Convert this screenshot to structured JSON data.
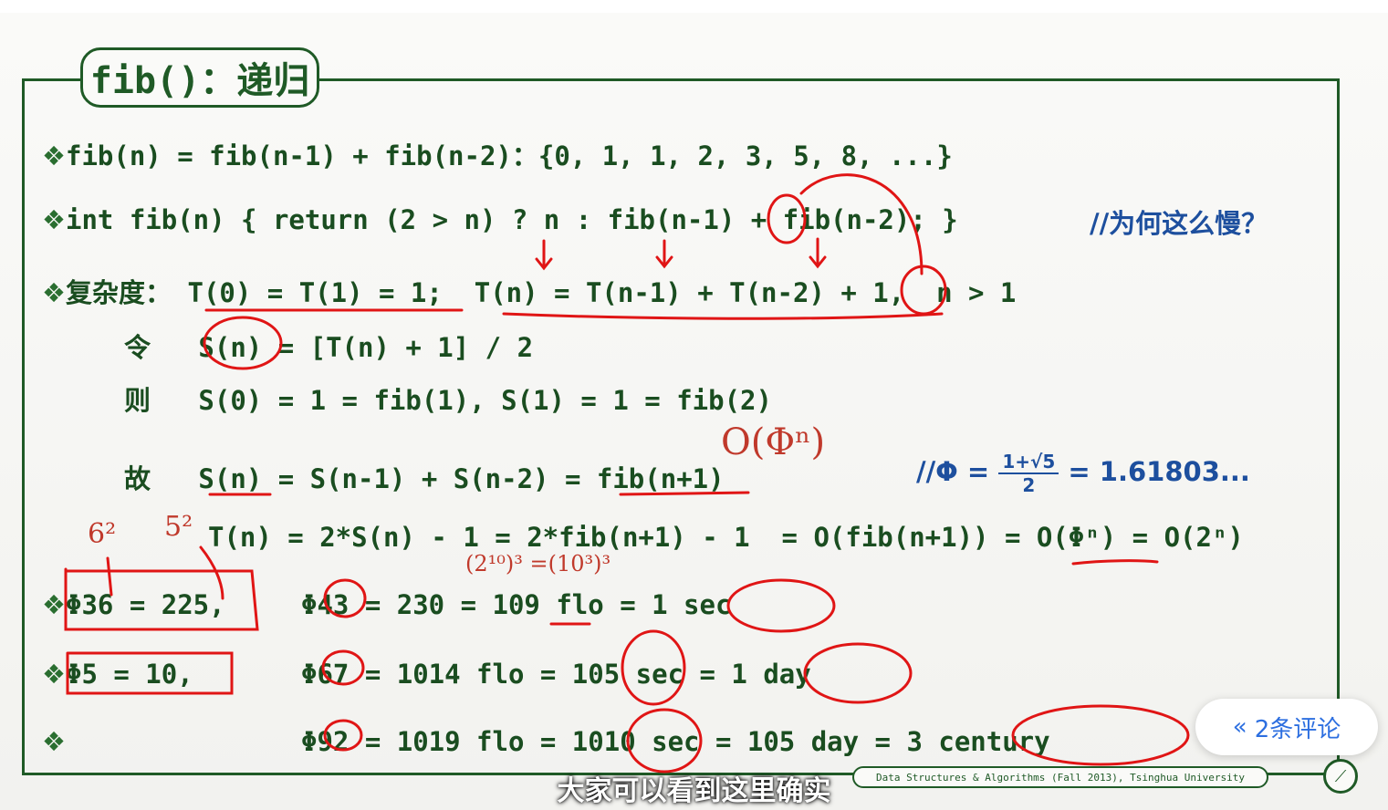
{
  "slide": {
    "title": "fib()：递归",
    "lines": {
      "l1": "fib(n) = fib(n-1) + fib(n-2)：{0, 1, 1, 2, 3, 5, 8, ...}",
      "l2": "int fib(n) { return (2 > n) ? n : fib(n-1) + fib(n-2); }",
      "l2_comment": "//为何这么慢？",
      "l3_label": "复杂度：",
      "l3": "T(0) = T(1) = 1;  T(n) = T(n-1) + T(n-2) + 1,  n > 1",
      "l4_label": "令",
      "l4": "S(n) = [T(n) + 1] / 2",
      "l5_label": "则",
      "l5": "S(0) = 1 = fib(1), S(1) = 1 = fib(2)",
      "l6_label": "故",
      "l6": "S(n) = S(n-1) + S(n-2) = fib(n+1)",
      "l6_comment_prefix": "//Φ =",
      "l6_frac_num": "1+√5",
      "l6_frac_den": "2",
      "l6_comment_suffix": "= 1.61803...",
      "l7": "T(n) = 2*S(n) - 1 = 2*fib(n+1) - 1  = O(fib(n+1)) = O(Φⁿ) = O(2ⁿ)",
      "l8a": "Φ36 = 225,",
      "l8b": "Φ43 = 230 = 109 flo = 1 sec",
      "l9a": "Φ5 = 10,",
      "l9b": "Φ67 = 1014 flo = 105 sec = 1 day",
      "l10b": "Φ92 = 1019 flo = 1010 sec = 105 day = 3 century"
    },
    "annotations": {
      "big_o": "O(Φⁿ)",
      "six_sq": "6²",
      "five_sq": "5²",
      "pow_note": "(2¹⁰)³ =(10³)³"
    },
    "footer": "Data Structures & Algorithms (Fall 2013), Tsinghua University"
  },
  "overlay": {
    "comments_button": "2条评论",
    "comments_icon": "double-chevron-left-icon",
    "subtitle": "大家可以看到这里确实"
  },
  "colors": {
    "slide_green": "#1f5a26",
    "comment_blue": "#1d4f9e",
    "ink_red": "#e01515",
    "link_blue": "#2d6fe0"
  }
}
